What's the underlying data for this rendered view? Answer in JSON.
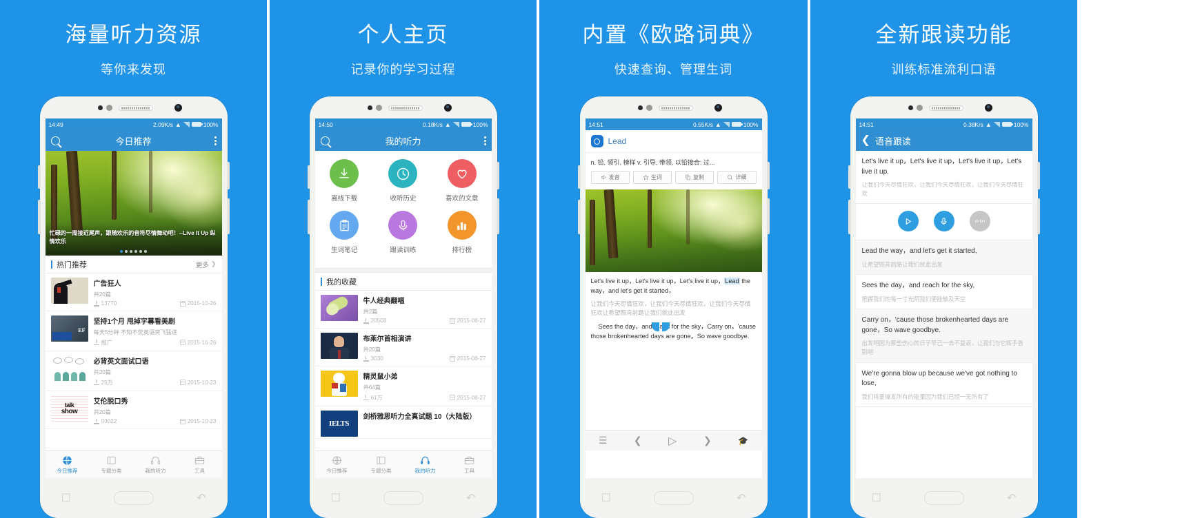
{
  "panels": [
    {
      "id": "panel-listening-resources",
      "title": "海量听力资源",
      "subtitle": "等你来发现",
      "status": {
        "time": "14:49",
        "net": "2.09K/s",
        "battery": "100%"
      },
      "appbar": {
        "title": "今日推荐",
        "search_icon": "search-icon",
        "more_icon": "more-vertical-icon"
      },
      "hero": {
        "caption": "忙碌的一周接近尾声，跟随欢乐的音符尽情舞动吧！--Live It Up\n纵情欢乐",
        "dots": 6,
        "active_dot": 1
      },
      "section": {
        "title": "热门推荐",
        "more": "更多"
      },
      "rows": [
        {
          "title": "广告狂人",
          "sub": "共20篇",
          "count": "13770",
          "date": "2015-10-26",
          "thumb": "mad-men-poster"
        },
        {
          "title": "坚持1个月 甩掉字幕看美剧",
          "sub": "每天5分钟 不知不觉英语突飞猛进",
          "count": "推广",
          "date": "2015-10-26",
          "thumb": "ef-ad"
        },
        {
          "title": "必背英文面试口语",
          "sub": "共20篇",
          "count": "25万",
          "date": "2015-10-23",
          "thumb": "people-talk"
        },
        {
          "title": "艾伦脱口秀",
          "sub": "共20篇",
          "count": "93022",
          "date": "2015-10-23",
          "thumb": "talk-show"
        }
      ],
      "tabs": [
        {
          "label": "今日推荐",
          "icon": "globe-icon",
          "active": true
        },
        {
          "label": "专题分类",
          "icon": "book-icon",
          "active": false
        },
        {
          "label": "我的听力",
          "icon": "headphone-icon",
          "active": false
        },
        {
          "label": "工具",
          "icon": "toolbox-icon",
          "active": false
        }
      ]
    },
    {
      "id": "panel-personal-home",
      "title": "个人主页",
      "subtitle": "记录你的学习过程",
      "status": {
        "time": "14:50",
        "net": "0.18K/s",
        "battery": "100%"
      },
      "appbar": {
        "title": "我的听力",
        "search_icon": "search-icon",
        "more_icon": "more-vertical-icon"
      },
      "grid": [
        {
          "label": "离线下载",
          "icon": "download-icon",
          "color": "#6cbf4b"
        },
        {
          "label": "收听历史",
          "icon": "clock-icon",
          "color": "#2bb3bf"
        },
        {
          "label": "喜欢的文章",
          "icon": "heart-icon",
          "color": "#ef5e63"
        },
        {
          "label": "生词笔记",
          "icon": "clipboard-icon",
          "color": "#64a8f0"
        },
        {
          "label": "跟读训练",
          "icon": "microphone-icon",
          "color": "#b濃"
        },
        {
          "label": "排行榜",
          "icon": "bar-chart-icon",
          "color": "#f2952a"
        }
      ],
      "grid_colors": [
        "#6cbf4b",
        "#2bb3bf",
        "#ef5e63",
        "#64a8f0",
        "#b878e0",
        "#f2952a"
      ],
      "section": {
        "title": "我的收藏"
      },
      "rows": [
        {
          "title": "牛人经典翻唱",
          "sub": "共2篇",
          "count": "20508",
          "date": "2015-08-27",
          "thumb": "microphone-photo"
        },
        {
          "title": "布莱尔首相演讲",
          "sub": "共20篇",
          "count": "3030",
          "date": "2015-08-27",
          "thumb": "blair-photo"
        },
        {
          "title": "精灵鼠小弟",
          "sub": "共64篇",
          "count": "61万",
          "date": "2015-08-27",
          "thumb": "stuart-little"
        },
        {
          "title": "剑桥雅思听力全真试题 10（大陆版）",
          "sub": "",
          "count": "",
          "date": "",
          "thumb": "ielts-cover"
        }
      ],
      "tabs": [
        {
          "label": "今日推荐",
          "icon": "globe-icon",
          "active": false
        },
        {
          "label": "专题分类",
          "icon": "book-icon",
          "active": false
        },
        {
          "label": "我的听力",
          "icon": "headphone-icon",
          "active": true
        },
        {
          "label": "工具",
          "icon": "toolbox-icon",
          "active": false
        }
      ]
    },
    {
      "id": "panel-dictionary",
      "title": "内置《欧路词典》",
      "subtitle": "快速查询、管理生词",
      "status": {
        "time": "14:51",
        "net": "0.55K/s",
        "battery": "100%"
      },
      "dict": {
        "word": "Lead",
        "definition": "n. 铅, 领引, 榜样 v. 引导, 带领, 以铅接合; 过...",
        "buttons": [
          {
            "label": "发音",
            "icon": "speaker-icon"
          },
          {
            "label": "生词",
            "icon": "star-icon"
          },
          {
            "label": "复制",
            "icon": "copy-icon"
          },
          {
            "label": "详细",
            "icon": "search-icon"
          }
        ]
      },
      "article": {
        "en1": "Let's live it up，Let's live it up，Let's live it up，",
        "hl": "Lead",
        "en1b": " the way，and let's get it started，",
        "cn1": "让我们今天尽情狂欢，让我们今天尽情狂欢，让我们今天尽情狂欢让希望照亮前路让我们就此出发",
        "en2": "Sees the day，and reach for the sky，Carry on，'cause those brokenhearted days are gone，So wave goodbye."
      },
      "player": [
        "list-icon",
        "prev-icon",
        "play-icon",
        "next-icon",
        "graduation-icon"
      ]
    },
    {
      "id": "panel-read-along",
      "title": "全新跟读功能",
      "subtitle": "训练标准流利口语",
      "status": {
        "time": "14:51",
        "net": "0.38K/s",
        "battery": "100%"
      },
      "appbar": {
        "title": "语音跟读",
        "back_icon": "chevron-left-icon"
      },
      "blocks": [
        {
          "en": "Let's live it up，Let's live it up，Let's live it up，Let's live it up.",
          "cn": "让我们今天尽情狂欢，让我们今天尽情狂欢，让我们今天尽情狂欢"
        },
        {
          "en": "Lead the way，and let's get it started,",
          "cn": "让希望照亮前路让我们就此出发"
        },
        {
          "en": "Sees the day，and reach for the sky,",
          "cn": "把握我们的每一寸光阴我们便能触及天空"
        },
        {
          "en": "Carry on，'cause those brokenhearted days are gone，So wave goodbye.",
          "cn": "出发吧因为那些伤心的日子早已一去不复返，让我们与它挥手告别吧"
        },
        {
          "en": "We're gonna blow up because we've got nothing to lose,",
          "cn": "我们将要爆发所有的能量因为我们已经一无所有了"
        }
      ],
      "controls": [
        {
          "icon": "play-icon",
          "style": "blue"
        },
        {
          "icon": "microphone-icon",
          "style": "blue"
        },
        {
          "icon": "waveform-icon",
          "style": "gray"
        }
      ]
    }
  ],
  "theme": {
    "brand_blue": "#1e93e8",
    "appbar_blue": "#2f8fd2",
    "statusbar_blue": "#2d8fd4"
  }
}
